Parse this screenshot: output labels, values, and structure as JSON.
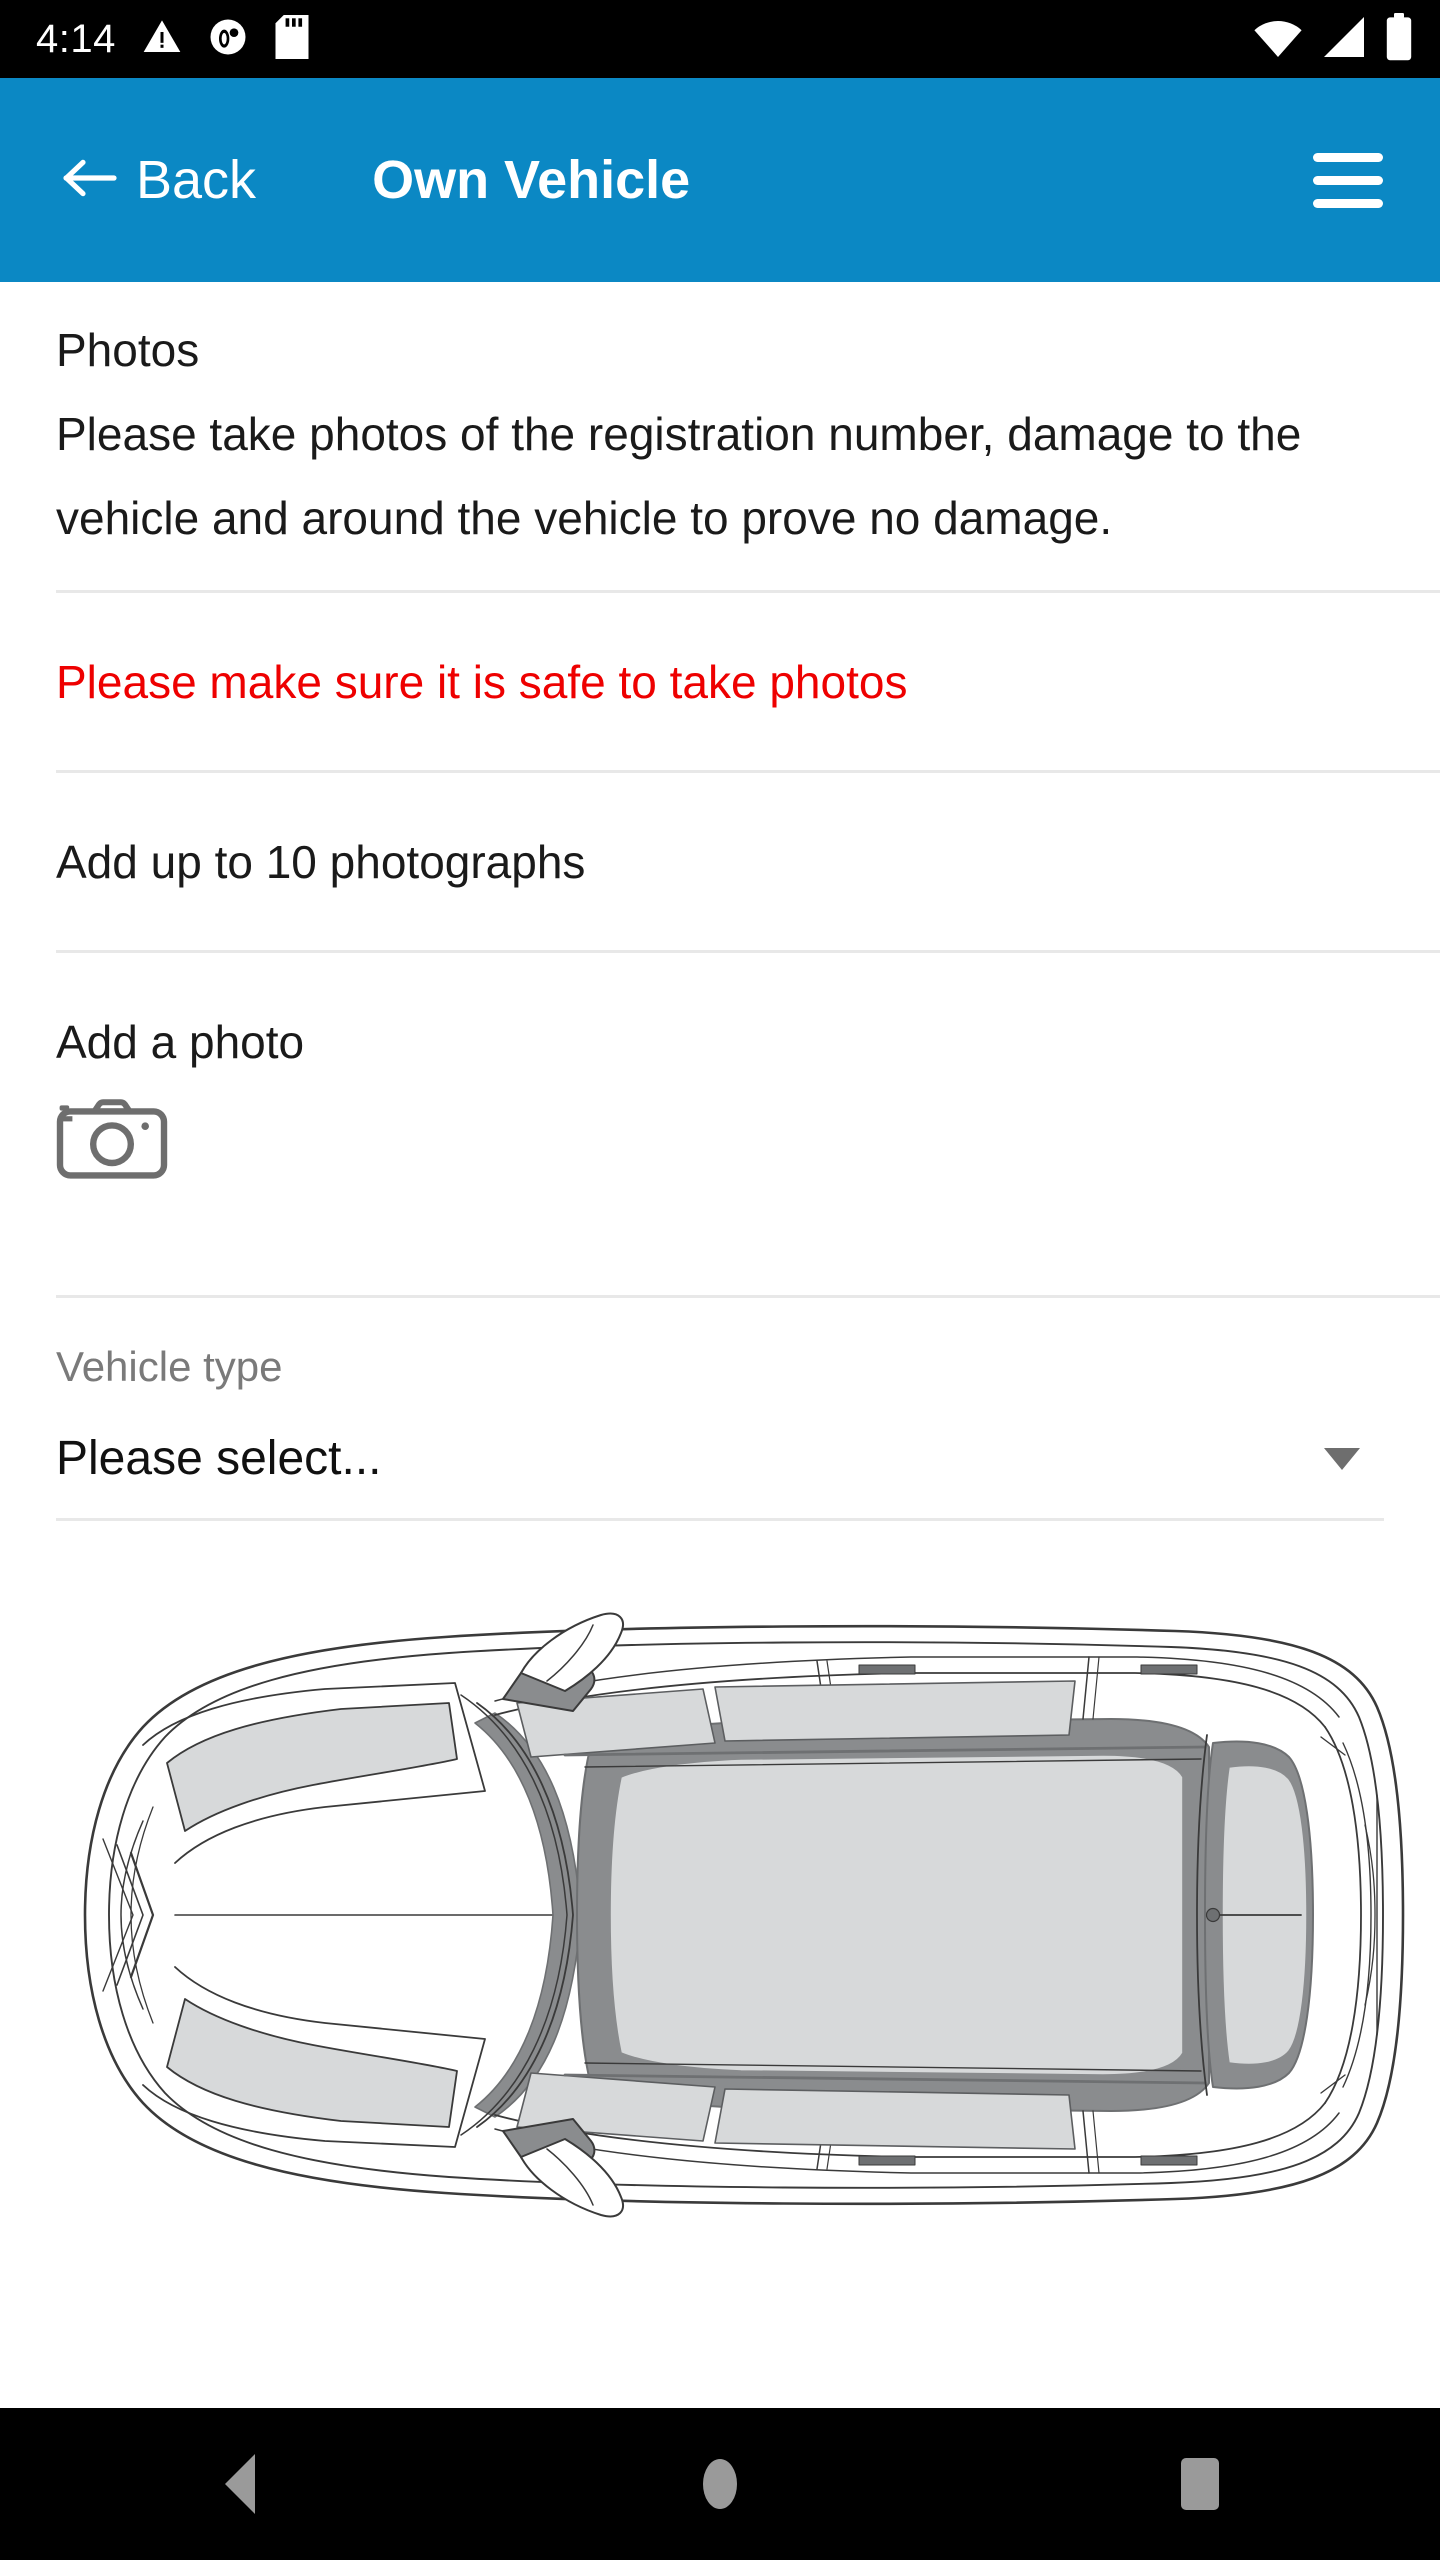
{
  "status_bar": {
    "clock": "4:14",
    "left_icons": [
      "warning-triangle-icon",
      "app-notification-icon",
      "sd-card-icon"
    ],
    "right_icons": [
      "wifi-icon",
      "cell-signal-icon",
      "battery-icon"
    ],
    "background": "#000000",
    "foreground": "#ffffff"
  },
  "app_bar": {
    "back_label": "Back",
    "title": "Own Vehicle",
    "menu_icon": "hamburger-menu-icon",
    "background": "#0b88c4",
    "foreground": "#ffffff"
  },
  "content": {
    "photos_heading": "Photos",
    "photos_instructions": "Please take photos of the registration number, damage to the vehicle and around the vehicle to prove no damage.",
    "safety_warning": "Please make sure it is safe to take photos",
    "safety_warning_color": "#ee0000",
    "photo_limit": "Add up to 10 photographs",
    "add_photo_label": "Add a photo",
    "camera_icon": "camera-icon",
    "vehicle_type": {
      "label": "Vehicle type",
      "value": "Please select...",
      "placeholder": "Please select...",
      "caret_icon": "chevron-down-icon"
    },
    "car_diagram": {
      "name": "vehicle-top-view-diagram",
      "description": "Top-down outline drawing of a car with shaded windscreen, roof, rear window and mirrors",
      "line_color": "#3a3a3a",
      "glass_fill": "#d7d9da",
      "trim_color": "#8a8c8e"
    }
  },
  "nav_bar": {
    "background": "#000000",
    "icon_color": "#9a9a9a",
    "buttons": [
      {
        "name": "nav-back-button",
        "icon": "triangle-back-icon"
      },
      {
        "name": "nav-home-button",
        "icon": "circle-home-icon"
      },
      {
        "name": "nav-recents-button",
        "icon": "square-recents-icon"
      }
    ]
  }
}
